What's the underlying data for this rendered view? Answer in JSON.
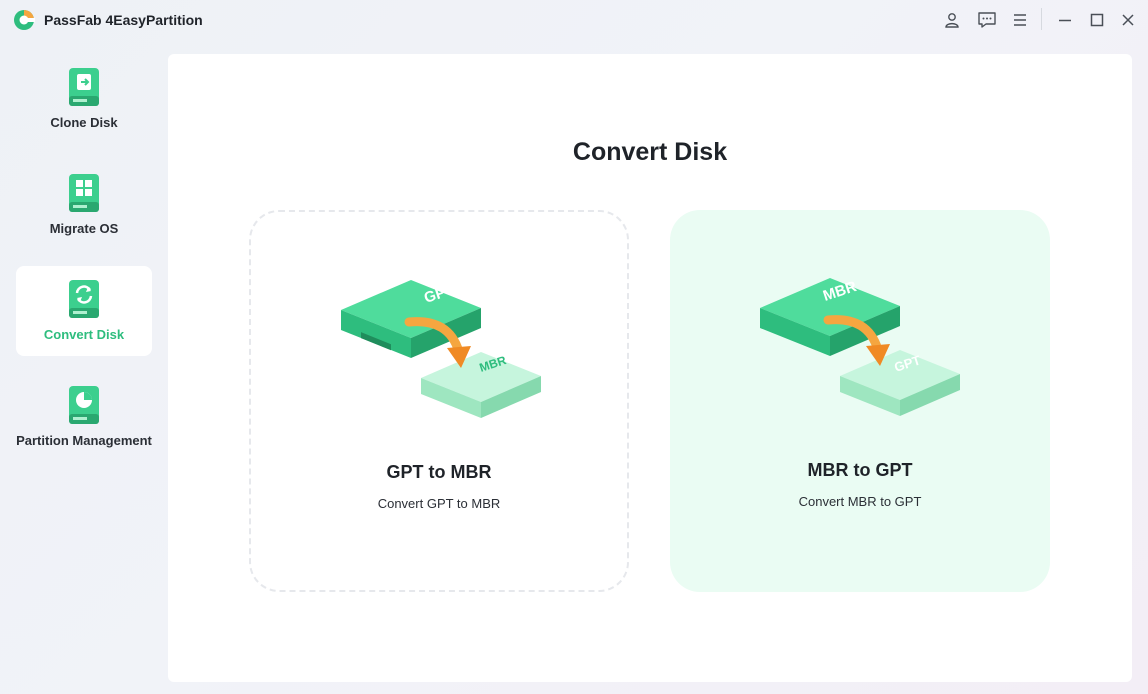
{
  "app": {
    "title": "PassFab 4EasyPartition"
  },
  "titlebar": {
    "icons": [
      "user-icon",
      "feedback-icon",
      "menu-icon",
      "minimize-icon",
      "maximize-icon",
      "close-icon"
    ]
  },
  "sidebar": {
    "items": [
      {
        "label": "Clone Disk",
        "icon": "clone-disk-icon",
        "active": false
      },
      {
        "label": "Migrate OS",
        "icon": "migrate-os-icon",
        "active": false
      },
      {
        "label": "Convert Disk",
        "icon": "convert-disk-icon",
        "active": true
      },
      {
        "label": "Partition Management",
        "icon": "partition-management-icon",
        "active": false
      }
    ]
  },
  "main": {
    "title": "Convert Disk",
    "cards": [
      {
        "title": "GPT to MBR",
        "subtitle": "Convert GPT to MBR",
        "from_label": "GPT",
        "to_label": "MBR"
      },
      {
        "title": "MBR to GPT",
        "subtitle": "Convert MBR to GPT",
        "from_label": "MBR",
        "to_label": "GPT"
      }
    ]
  },
  "colors": {
    "accent": "#2ebd7e",
    "disk_dark": "#3ccf8e",
    "disk_light": "#a8ecc9",
    "arrow": "#f5a640",
    "card_selected_bg": "#eafcf3"
  }
}
